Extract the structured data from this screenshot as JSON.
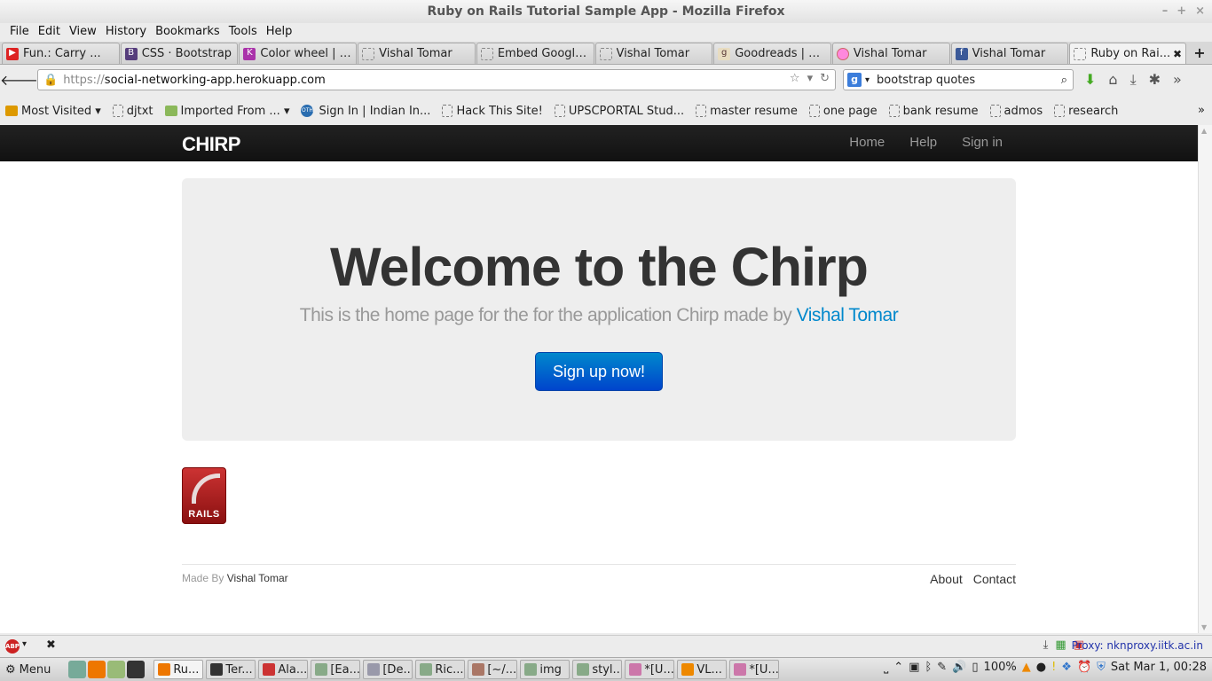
{
  "window": {
    "title": "Ruby on Rails Tutorial Sample App - Mozilla Firefox",
    "min": "–",
    "max": "+",
    "close": "×"
  },
  "menu": [
    "File",
    "Edit",
    "View",
    "History",
    "Bookmarks",
    "Tools",
    "Help"
  ],
  "tabs": [
    {
      "label": "Fun.: Carry ...",
      "icon": "youtube-icon"
    },
    {
      "label": "CSS · Bootstrap",
      "icon": "bootstrap-icon"
    },
    {
      "label": "Color wheel | C...",
      "icon": "colorwheel-icon"
    },
    {
      "label": "Vishal Tomar",
      "icon": "blank-page-icon"
    },
    {
      "label": "Embed Google...",
      "icon": "blank-page-icon"
    },
    {
      "label": "Vishal Tomar",
      "icon": "blank-page-icon"
    },
    {
      "label": "Goodreads | Q...",
      "icon": "goodreads-icon"
    },
    {
      "label": "Vishal Tomar",
      "icon": "stamp-icon"
    },
    {
      "label": "Vishal Tomar",
      "icon": "facebook-icon"
    },
    {
      "label": "Ruby on Rai...",
      "icon": "blank-page-icon",
      "active": true
    }
  ],
  "nav": {
    "url_proto": "https://",
    "url_host": "social-networking-app.herokuapp.com",
    "search_value": "bootstrap quotes"
  },
  "bookmarks": [
    {
      "label": "Most Visited ▾",
      "icon": "most-visited-icon"
    },
    {
      "label": "djtxt",
      "icon": "blank-page-icon"
    },
    {
      "label": "Imported From ... ▾",
      "icon": "folder-icon"
    },
    {
      "label": "Sign In | Indian In...",
      "icon": "oth-icon"
    },
    {
      "label": "Hack This Site!",
      "icon": "blank-page-icon"
    },
    {
      "label": "UPSCPORTAL Stud...",
      "icon": "blank-page-icon"
    },
    {
      "label": "master resume",
      "icon": "blank-page-icon"
    },
    {
      "label": "one page",
      "icon": "blank-page-icon"
    },
    {
      "label": "bank resume",
      "icon": "blank-page-icon"
    },
    {
      "label": "admos",
      "icon": "blank-page-icon"
    },
    {
      "label": "research",
      "icon": "blank-page-icon"
    }
  ],
  "site": {
    "brand": "CHIRP",
    "links": [
      "Home",
      "Help",
      "Sign in"
    ],
    "hero_title": "Welcome to the Chirp",
    "hero_sub": "This is the home page for the for the application Chirp made by ",
    "hero_author": "Vishal Tomar",
    "signup_label": "Sign up now!",
    "rails_text": "RAILS",
    "footer_made": "Made By ",
    "footer_author": "Vishal Tomar",
    "footer_links": [
      "About",
      "Contact"
    ]
  },
  "addon": {
    "abp": "ABP",
    "proxy": "Proxy: nknproxy.iitk.ac.in"
  },
  "taskbar": {
    "menu_label": "Menu",
    "items": [
      "Ru...",
      "Ter...",
      "Ala...",
      "[Ea...",
      "[De...",
      "Ric...",
      "[~/...",
      "img",
      "styl...",
      "*[U...",
      "VL...",
      "*[U..."
    ],
    "battery": "100%",
    "clock": "Sat Mar  1, 00:28"
  },
  "colors": {
    "link": "#0088cc",
    "navbar": "#1b1b1b",
    "button": "#0066cc"
  }
}
